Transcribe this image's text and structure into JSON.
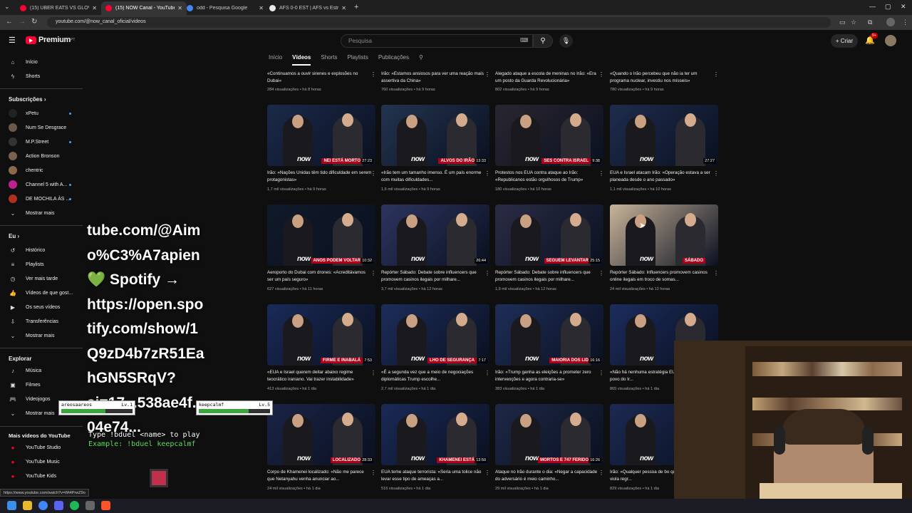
{
  "tabs": [
    {
      "title": "(15) UBER EATS VS GLOVO | C...",
      "active": false,
      "color": "#ff0033"
    },
    {
      "title": "(15) NOW Canal - YouTube",
      "active": true,
      "color": "#ff0033"
    },
    {
      "title": "odd - Pesquisa Google",
      "active": false,
      "color": "#4285f4"
    },
    {
      "title": "AFS 0-0 EST | AFS vs Estrela da...",
      "active": false,
      "color": "#e8eaed"
    }
  ],
  "address": {
    "url": "youtube.com/@now_canal_oficial/videos"
  },
  "header": {
    "brand": "Premium",
    "region": "PT",
    "search_placeholder": "Pesquisa",
    "create_label": "Criar",
    "notif_count": "9+"
  },
  "sidebar": {
    "home": "Início",
    "shorts": "Shorts",
    "subs_heading": "Subscrições",
    "subs": [
      {
        "name": "xPetu",
        "color": "#222",
        "dot": true
      },
      {
        "name": "Num Se Desgrace",
        "color": "#6a5a4a",
        "dot": false
      },
      {
        "name": "M.P.Street",
        "color": "#333",
        "dot": true
      },
      {
        "name": "Action Bronson",
        "color": "#7a6050",
        "dot": false
      },
      {
        "name": "chentric",
        "color": "#8a6a4a",
        "dot": false
      },
      {
        "name": "Channel 5 with A...",
        "color": "#c02090",
        "dot": true
      },
      {
        "name": "DE MOCHILA ÀS ...",
        "color": "#b03020",
        "dot": true
      }
    ],
    "show_more": "Mostrar mais",
    "you_heading": "Eu",
    "you_items": [
      "Histórico",
      "Playlists",
      "Ver mais tarde",
      "Vídeos de que gost...",
      "Os seus vídeos",
      "Transferências",
      "Mostrar mais"
    ],
    "explore_heading": "Explorar",
    "explore_items": [
      "Música",
      "Filmes",
      "Videojogos",
      "Mostrar mais"
    ],
    "more_heading": "Mais vídeos do YouTube",
    "more_items": [
      "YouTube Studio",
      "YouTube Music",
      "YouTube Kids"
    ]
  },
  "channel_tabs": [
    "Início",
    "Vídeos",
    "Shorts",
    "Playlists",
    "Publicações"
  ],
  "row0": [
    {
      "title": "«Continuamos a ouvir sirenes e explosões no Dubai»",
      "meta": "284 visualizações • há 8 horas"
    },
    {
      "title": "Irão: «Estamos ansiosos para ver uma reação mais assertiva da China»",
      "meta": "760 visualizações • há 9 horas"
    },
    {
      "title": "Alegado ataque a escola de meninas no Irão: «Era um posto da Guarda Revolucionária»",
      "meta": "802 visualizações • há 9 horas"
    },
    {
      "title": "«Quando o Irão percebeu que não ia ter um programa nuclear, investiu nos mísseis»",
      "meta": "780 visualizações • há 9 horas"
    }
  ],
  "videos": [
    {
      "title": "Irão: «Nações Unidas têm tido dificuldade em serem protagonistas»",
      "meta": "1,7 mil visualizações • há 9 horas",
      "duration": "27:23",
      "caption": "NEI ESTÁ MORTO",
      "bg": "#1b2a4a"
    },
    {
      "title": "«Irão tem um tamanho imenso. É um país enorme com muitas dificuldades...",
      "meta": "1,6 mil visualizações • há 9 horas",
      "duration": "13:33",
      "caption": "ALVOS DO IRÃO",
      "bg": "#23344f"
    },
    {
      "title": "Protestos nos EUA contra ataque ao Irão: «Republicanos estão orgulhosos de Trump»",
      "meta": "180 visualizações • há 10 horas",
      "duration": "9:38",
      "caption": "SES CONTRA ISRAEL",
      "bg": "#2a2630"
    },
    {
      "title": "EUA e Israel atacam Irão: «Operação estava a ser planeada desde o ano passado»",
      "meta": "1,1 mil visualizações • há 10 horas",
      "duration": "27:27",
      "caption": "",
      "bg": "#1e2c4c"
    },
    {
      "title": "Aeroporto do Dubai com drones: «Acreditávamos ser um país seguro»",
      "meta": "627 visualizações • há 11 horas",
      "duration": "10:32",
      "caption": "ANOS PODEM VOLTAR",
      "bg": "#111a2a"
    },
    {
      "title": "Repórter Sábado: Debate sobre influencers que promovem casinos ilegais por milhare...",
      "meta": "3,7 mil visualizações • há 12 horas",
      "duration": "26:44",
      "caption": "",
      "bg": "#2d3560"
    },
    {
      "title": "Repórter Sábado: Debate sobre influencers que promovem casinos ilegais por milhare...",
      "meta": "1,9 mil visualizações • há 12 horas",
      "duration": "25:15",
      "caption": "SEGUEM LEVANTAR",
      "bg": "#2a2c44"
    },
    {
      "title": "Repórter Sábado: Influencers promovem casinos online ilegais em troco de somas...",
      "meta": "24 mil visualizações • há 12 horas",
      "duration": "",
      "caption": "SÁBADO",
      "bg": "#c8b49a"
    },
    {
      "title": "«EUA e Israel querem deitar abaixo regime teocrático iraniano. Vai trazer instabilidade»",
      "meta": "413 visualizações • há 1 dia",
      "duration": "7:53",
      "caption": "FIRME E INABALÁ",
      "bg": "#1a2a58"
    },
    {
      "title": "«É a segunda vez que a meio de negociações diplomáticas Trump escolhe...",
      "meta": "2,7 mil visualizações • há 1 dia",
      "duration": "7:17",
      "caption": "LHO DE SEGURANÇA",
      "bg": "#1d2d5a"
    },
    {
      "title": "Irão: «Trump ganha as eleições a prometer zero intervenções e agora contraria-se»",
      "meta": "383 visualizações • há 1 dia",
      "duration": "16:16",
      "caption": "MAIORIA DOS LID",
      "bg": "#1e2e58"
    },
    {
      "title": "«Não há nenhuma estratégia EUA para libertar o povo do Ir...",
      "meta": "865 visualizações • há 1 dia",
      "duration": "",
      "caption": "OS",
      "bg": "#1c2c5c"
    },
    {
      "title": "Corpo de Khamenei localizado: «Não me parece que Netanyahu venha anunciar ao...",
      "meta": "24 mil visualizações • há 1 dia",
      "duration": "28:33",
      "caption": "LOCALIZADO",
      "bg": "#1a2446"
    },
    {
      "title": "EUA teme ataque terrorista: «Seria uma tolice não levar esse tipo de ameaças a...",
      "meta": "516 visualizações • há 1 dia",
      "duration": "13:50",
      "caption": "KHAMENEI ESTÁ",
      "bg": "#1a2a56"
    },
    {
      "title": "Ataque no Irão durante o dia: «Negar a capacidade do adversário é meio caminho...",
      "meta": "29 mil visualizações • há 1 dia",
      "duration": "16:26",
      "caption": "MORTOS E 747 FERIDO",
      "bg": "#1e2846"
    },
    {
      "title": "Irão: «Qualquer pessoa de bo que esta operação viola regr...",
      "meta": "829 visualizações • há 1 dia",
      "duration": "",
      "caption": "",
      "bg": "#1c2a52"
    }
  ],
  "thumb_brand": "now",
  "overlay": {
    "lines": [
      "tube.com/@Aim",
      "o%C3%A7apien",
      "💚 Spotify →",
      "https://open.spo",
      "tify.com/show/1",
      "Q9zD4b7zR51Ea",
      "hGN5SRqV?",
      "si=17...538ae4f...",
      "04e74..."
    ]
  },
  "game": {
    "players": [
      {
        "name": "areosaareos",
        "level": "Lv.1",
        "hp": 0.62
      },
      {
        "name": "keepcalmf",
        "level": "Lv.5",
        "hp": 0.7
      }
    ],
    "cmd1": "Type !bduel <name> to play",
    "cmd2": "Example: !bduel keepcalmf"
  },
  "status_url": "https://www.youtube.com/watch?v=Wt4PrwZ9o"
}
